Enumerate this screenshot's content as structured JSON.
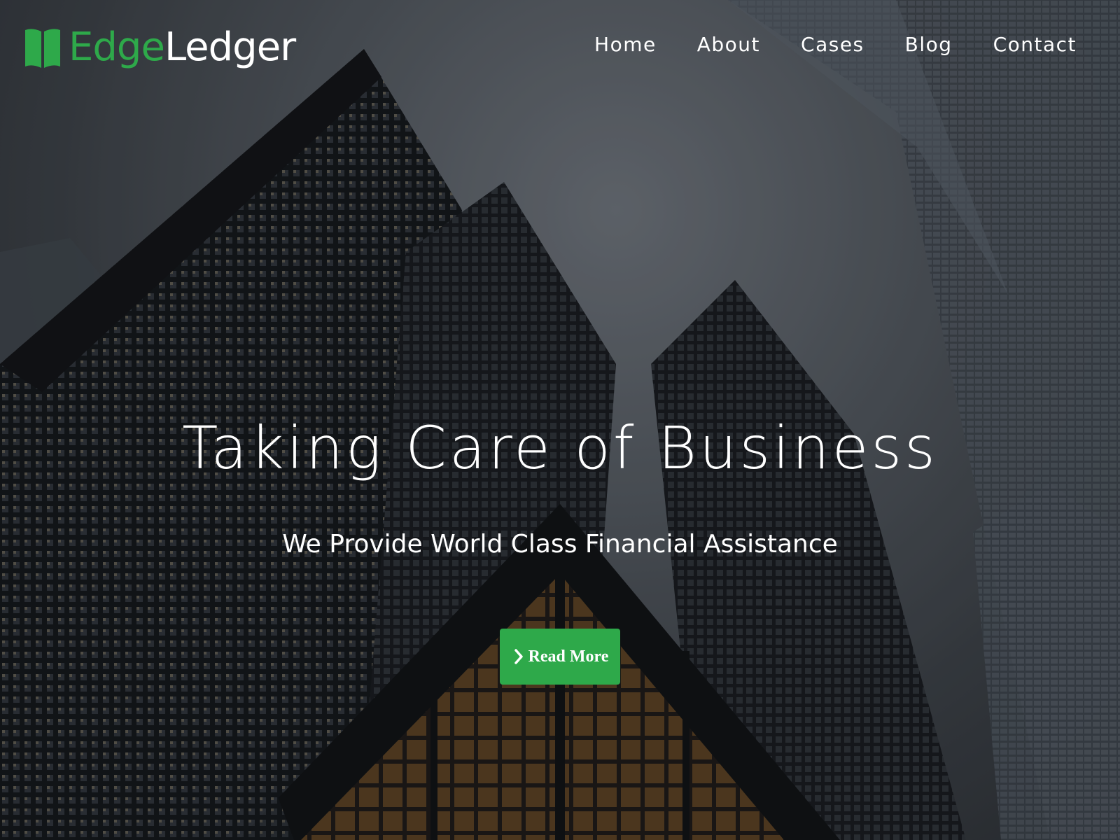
{
  "brand": {
    "name_part1": "Edge",
    "name_part2": "Ledger",
    "icon": "open-book-icon",
    "accent_color": "#2ea94a"
  },
  "nav": {
    "items": [
      {
        "label": "Home"
      },
      {
        "label": "About"
      },
      {
        "label": "Cases"
      },
      {
        "label": "Blog"
      },
      {
        "label": "Contact"
      }
    ]
  },
  "hero": {
    "title": "Taking Care of Business",
    "subtitle": "We Provide World Class Financial Assistance",
    "background": "skyscrapers-photo",
    "cta": {
      "label": "Read More",
      "icon": "chevron-right-icon",
      "color": "#2ea94a"
    }
  }
}
